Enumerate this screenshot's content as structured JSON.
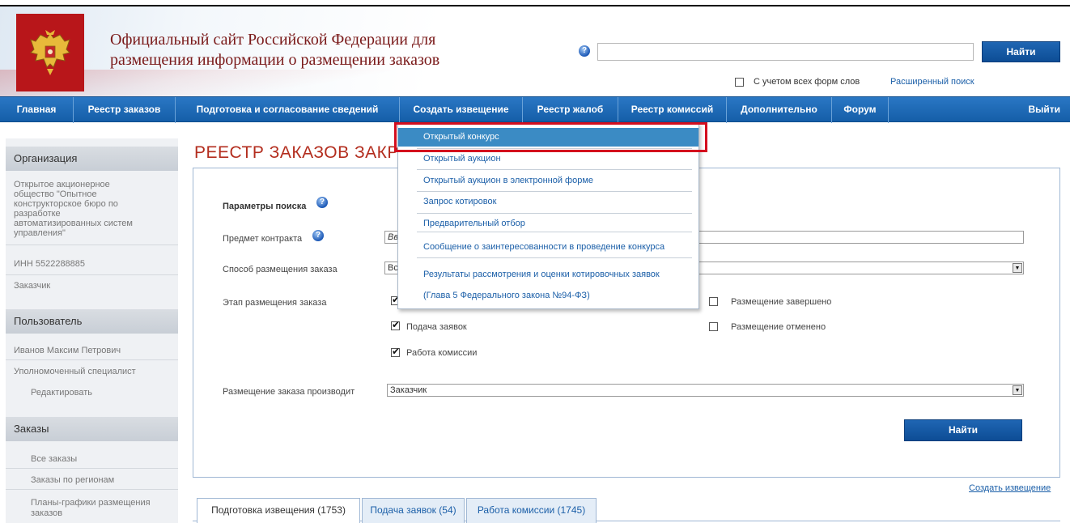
{
  "header": {
    "site_title_line1": "Официальный сайт Российской Федерации для",
    "site_title_line2": "размещения информации о размещении заказов",
    "search_button": "Найти",
    "word_forms_label": "С учетом всех форм слов",
    "advanced_search": "Расширенный поиск"
  },
  "nav": {
    "items": [
      "Главная",
      "Реестр заказов",
      "Подготовка и согласование сведений",
      "Создать извещение",
      "Реестр жалоб",
      "Реестр комиссий",
      "Дополнительно",
      "Форум"
    ],
    "logout": "Выйти"
  },
  "dropdown": {
    "items": [
      "Открытый конкурс",
      "Открытый аукцион",
      "Открытый аукцион в электронной форме",
      "Запрос котировок",
      "Предварительный отбор",
      "Сообщение о заинтересованности в проведение конкурса",
      "Результаты рассмотрения и оценки котировочных заявок",
      "(Глава 5 Федерального закона №94-ФЗ)"
    ]
  },
  "sidebar": {
    "org_heading": "Организация",
    "org_name_lines": [
      "Открытое акционерное",
      "общество \"Опытное",
      "конструкторское бюро по",
      "разработке",
      "автоматизированных систем",
      "управления\""
    ],
    "inn": "ИНН 5522288885",
    "role": "Заказчик",
    "user_heading": "Пользователь",
    "user_name": "Иванов Максим Петрович",
    "user_role": "Уполномоченный специалист",
    "edit_link": "Редактировать",
    "orders_heading": "Заказы",
    "orders_links": [
      "Все заказы",
      "Заказы по регионам",
      "Планы-графики размещения",
      "заказов"
    ]
  },
  "main": {
    "page_title": "РЕЕСТР ЗАКАЗОВ ЗАКР",
    "params_label": "Параметры поиска",
    "subject_label": "Предмет контракта",
    "subject_value": "Вв",
    "method_label": "Способ размещения заказа",
    "method_value": "Вс",
    "stage_label": "Этап размещения заказа",
    "stages": {
      "submission": "Подача заявок",
      "commission": "Работа комиссии",
      "completed": "Размещение завершено",
      "cancelled": "Размещение отменено"
    },
    "placer_label": "Размещение заказа производит",
    "placer_value": "Заказчик",
    "search_button": "Найти",
    "create_notice_link": "Создать извещение"
  },
  "tabs": [
    "Подготовка извещения (1753)",
    "Подача заявок (54)",
    "Работа комиссии (1745)"
  ]
}
